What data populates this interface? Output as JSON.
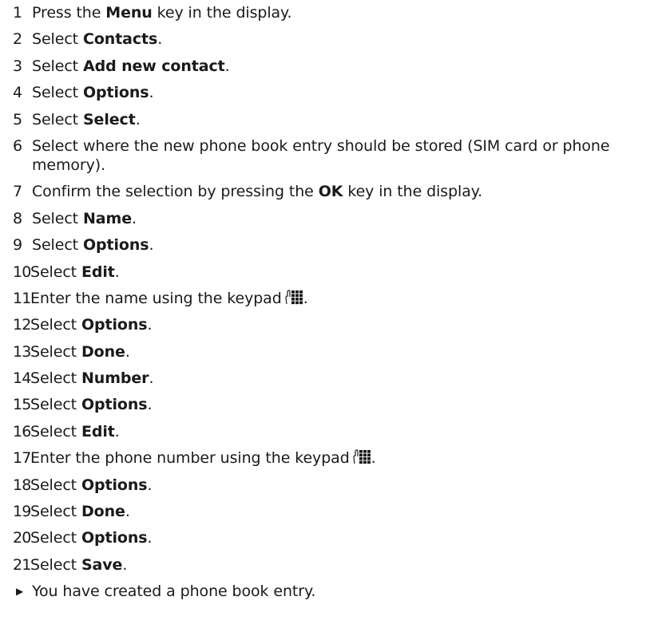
{
  "steps": [
    {
      "num": "1",
      "pre": "Press the ",
      "bold": "Menu",
      "post": " key in the display."
    },
    {
      "num": "2",
      "pre": "Select ",
      "bold": "Contacts",
      "post": "."
    },
    {
      "num": "3",
      "pre": "Select ",
      "bold": "Add new contact",
      "post": "."
    },
    {
      "num": "4",
      "pre": "Select ",
      "bold": "Options",
      "post": "."
    },
    {
      "num": "5",
      "pre": "Select ",
      "bold": "Select",
      "post": "."
    },
    {
      "num": "6",
      "text": "Select where the new phone book entry should be stored (SIM card or phone memory)."
    },
    {
      "num": "7",
      "pre": "Confirm the selection by pressing the ",
      "bold": "OK",
      "post": " key in the display."
    },
    {
      "num": "8",
      "pre": "Select ",
      "bold": "Name",
      "post": "."
    },
    {
      "num": "9",
      "pre": "Select ",
      "bold": "Options",
      "post": "."
    },
    {
      "num": "10",
      "pre": "Select ",
      "bold": "Edit",
      "post": "."
    },
    {
      "num": "11",
      "text": "Enter the name using the keypad",
      "icon": "keypad-icon",
      "post": "."
    },
    {
      "num": "12",
      "pre": "Select ",
      "bold": "Options",
      "post": "."
    },
    {
      "num": "13",
      "pre": "Select ",
      "bold": "Done",
      "post": "."
    },
    {
      "num": "14",
      "pre": "Select ",
      "bold": "Number",
      "post": "."
    },
    {
      "num": "15",
      "pre": "Select ",
      "bold": "Options",
      "post": "."
    },
    {
      "num": "16",
      "pre": "Select ",
      "bold": "Edit",
      "post": "."
    },
    {
      "num": "17",
      "text": "Enter the phone number using the keypad",
      "icon": "keypad-icon",
      "post": "."
    },
    {
      "num": "18",
      "pre": "Select ",
      "bold": "Options",
      "post": "."
    },
    {
      "num": "19",
      "pre": "Select ",
      "bold": "Done",
      "post": "."
    },
    {
      "num": "20",
      "pre": "Select ",
      "bold": "Options",
      "post": "."
    },
    {
      "num": "21",
      "pre": "Select ",
      "bold": "Save",
      "post": "."
    }
  ],
  "result": {
    "icon": "triangle-right-icon",
    "text": "You have created a phone book entry."
  }
}
